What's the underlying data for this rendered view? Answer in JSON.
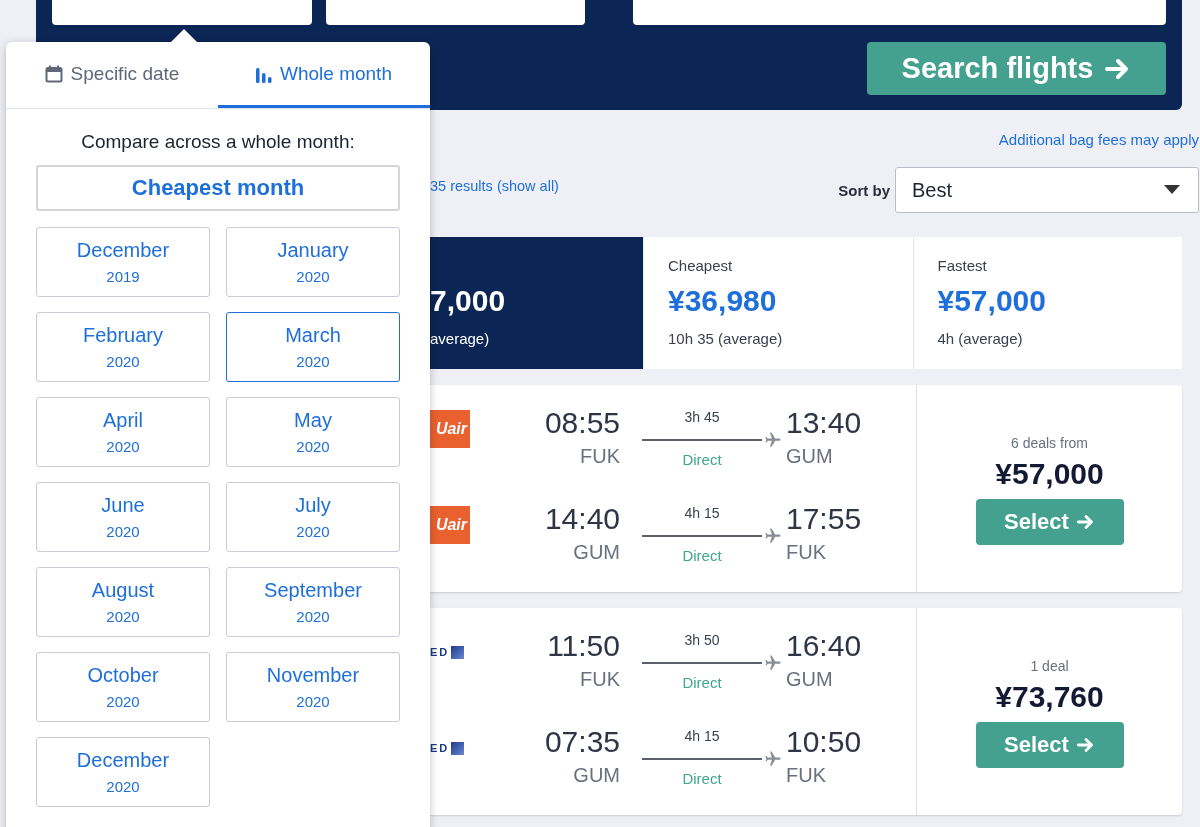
{
  "search_button": {
    "label": "Search flights"
  },
  "date_picker": {
    "tabs": [
      {
        "label": "Specific date",
        "selected": false
      },
      {
        "label": "Whole month",
        "selected": true
      }
    ],
    "heading": "Compare across a whole month:",
    "cheapest_button": "Cheapest month",
    "months": [
      {
        "month": "December",
        "year": "2019",
        "selected": false
      },
      {
        "month": "January",
        "year": "2020",
        "selected": false
      },
      {
        "month": "February",
        "year": "2020",
        "selected": false
      },
      {
        "month": "March",
        "year": "2020",
        "selected": true
      },
      {
        "month": "April",
        "year": "2020",
        "selected": false
      },
      {
        "month": "May",
        "year": "2020",
        "selected": false
      },
      {
        "month": "June",
        "year": "2020",
        "selected": false
      },
      {
        "month": "July",
        "year": "2020",
        "selected": false
      },
      {
        "month": "August",
        "year": "2020",
        "selected": false
      },
      {
        "month": "September",
        "year": "2020",
        "selected": false
      },
      {
        "month": "October",
        "year": "2020",
        "selected": false
      },
      {
        "month": "November",
        "year": "2020",
        "selected": false
      },
      {
        "month": "December",
        "year": "2020",
        "selected": false
      }
    ]
  },
  "notice": "Additional bag fees may apply",
  "results_link": "35 results (show all)",
  "sort": {
    "label": "Sort by",
    "value": "Best"
  },
  "summary_tabs": [
    {
      "price": "7,000",
      "duration": "average)",
      "selected": true
    },
    {
      "label": "Cheapest",
      "price": "¥36,980",
      "duration": "10h 35 (average)",
      "selected": false
    },
    {
      "label": "Fastest",
      "price": "¥57,000",
      "duration": "4h (average)",
      "selected": false
    }
  ],
  "itineraries": [
    {
      "legs": [
        {
          "logo": {
            "kind": "box",
            "text": "Uair"
          },
          "depart": "08:55",
          "from": "FUK",
          "duration": "3h 45",
          "stops": "Direct",
          "arrive": "13:40",
          "to": "GUM"
        },
        {
          "logo": {
            "kind": "box",
            "text": "Uair"
          },
          "depart": "14:40",
          "from": "GUM",
          "duration": "4h 15",
          "stops": "Direct",
          "arrive": "17:55",
          "to": "FUK"
        }
      ],
      "deals": "6 deals from",
      "price": "¥57,000",
      "button": "Select"
    },
    {
      "legs": [
        {
          "logo": {
            "kind": "mark",
            "text": "ED"
          },
          "depart": "11:50",
          "from": "FUK",
          "duration": "3h 50",
          "stops": "Direct",
          "arrive": "16:40",
          "to": "GUM"
        },
        {
          "logo": {
            "kind": "mark",
            "text": "ED"
          },
          "depart": "07:35",
          "from": "GUM",
          "duration": "4h 15",
          "stops": "Direct",
          "arrive": "10:50",
          "to": "FUK"
        }
      ],
      "deals": "1 deal",
      "price": "¥73,760",
      "button": "Select"
    }
  ]
}
